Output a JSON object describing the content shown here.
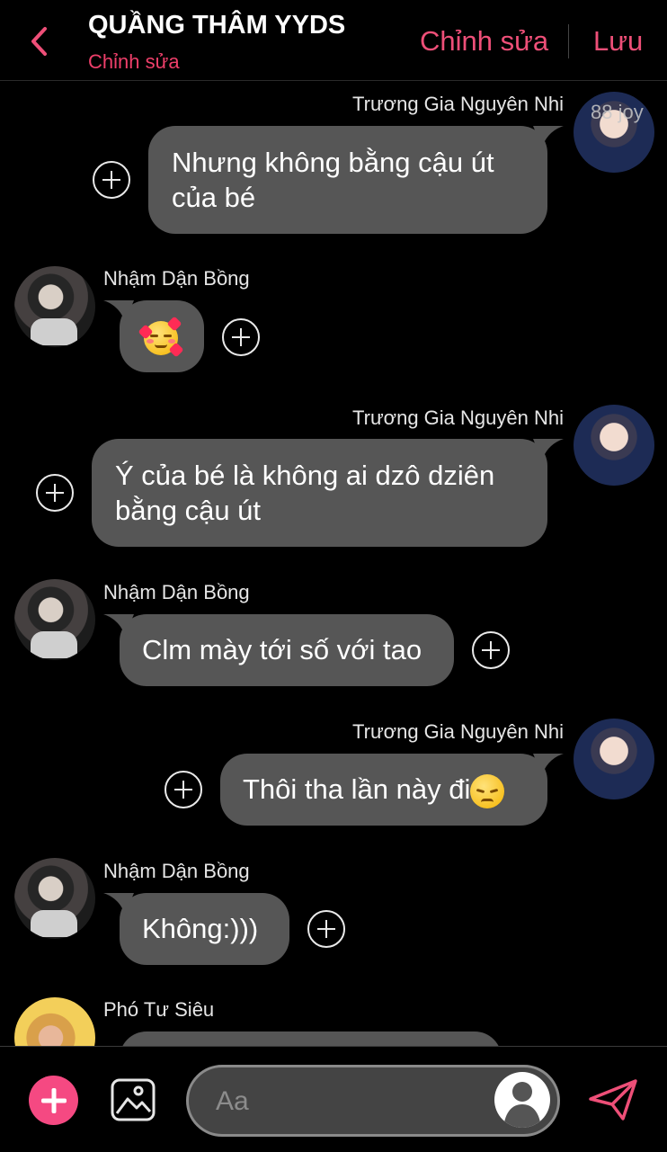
{
  "header": {
    "title": "QUẦNG THÂM YYDS",
    "subtitle": "Chỉnh sửa",
    "edit_label": "Chỉnh sửa",
    "save_label": "Lưu"
  },
  "watermark": "88 joy",
  "messages": [
    {
      "sender": "Trương Gia Nguyên Nhi",
      "side": "right",
      "lines": [
        "Nhưng không bằng cậu út",
        "của bé"
      ]
    },
    {
      "sender": "Nhậm Dận Bồng",
      "side": "left",
      "emoji": "smiling-face-with-hearts"
    },
    {
      "sender": "Trương Gia Nguyên Nhi",
      "side": "right",
      "lines": [
        "Ý của bé là không ai dzô dziên",
        "bằng cậu út"
      ]
    },
    {
      "sender": "Nhậm Dận Bồng",
      "side": "left",
      "lines": [
        "Clm mày tới số với tao"
      ]
    },
    {
      "sender": "Trương Gia Nguyên Nhi",
      "side": "right",
      "lines": [
        "Thôi tha lần này đi"
      ],
      "emoji": "pensive-face"
    },
    {
      "sender": "Nhậm Dận Bồng",
      "side": "left",
      "lines": [
        "Không:)))"
      ]
    },
    {
      "sender": "Phó Tư Siêu",
      "side": "left",
      "lines": []
    }
  ],
  "composer": {
    "placeholder": "Aa"
  },
  "colors": {
    "accent": "#ee4f78",
    "bubble": "#565656",
    "background": "#000000"
  },
  "icons": [
    "back-chevron-icon",
    "add-icon",
    "image-icon",
    "send-icon",
    "reaction-add-icon"
  ]
}
